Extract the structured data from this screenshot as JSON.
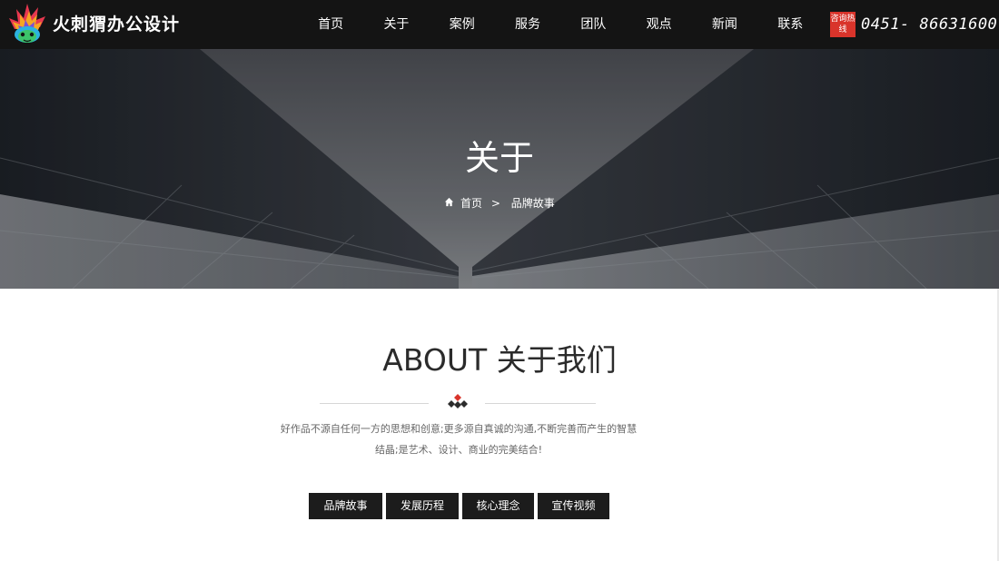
{
  "header": {
    "brand": "火刺猬办公设计",
    "nav": [
      "首页",
      "关于",
      "案例",
      "服务",
      "团队",
      "观点",
      "新闻",
      "联系"
    ],
    "hotline_label": "咨询热线",
    "phone": "0451- 86631600"
  },
  "banner": {
    "title": "关于",
    "breadcrumb": {
      "home": "首页",
      "separator": ">",
      "current": "品牌故事"
    }
  },
  "about": {
    "title": "ABOUT 关于我们",
    "desc_line1": "好作品不源自任何一方的思想和创意;更多源自真诚的沟通,不断完善而产生的智慧",
    "desc_line2": "结晶;是艺术、设计、商业的完美结合!",
    "tabs": [
      "品牌故事",
      "发展历程",
      "核心理念",
      "宣传视频"
    ]
  },
  "colors": {
    "header_bg": "#141414",
    "accent_red": "#d9342b",
    "tab_bg": "#1c1c1c"
  }
}
